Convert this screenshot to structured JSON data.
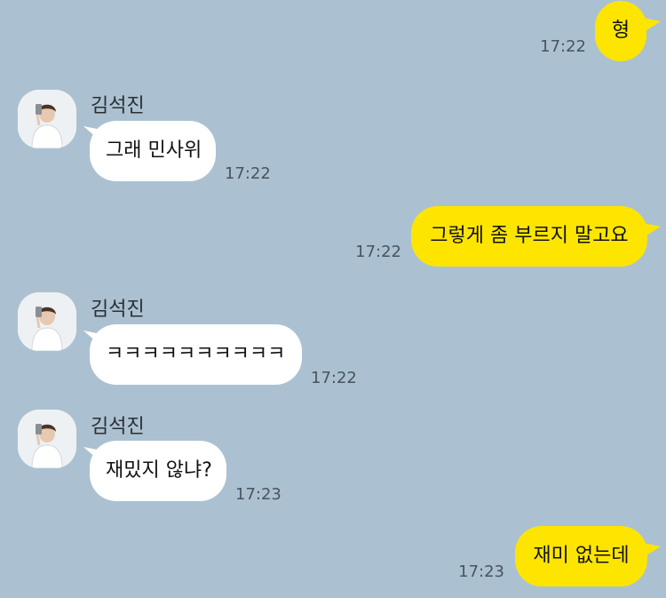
{
  "chat": {
    "messages": [
      {
        "sender": "me",
        "text": "형",
        "time": "17:22"
      },
      {
        "sender": "김석진",
        "text": "그래 민사위",
        "time": "17:22"
      },
      {
        "sender": "me",
        "text": "그렇게 좀 부르지 말고요",
        "time": "17:22"
      },
      {
        "sender": "김석진",
        "text": "ㅋㅋㅋㅋㅋㅋㅋㅋㅋㅋ",
        "time": "17:22"
      },
      {
        "sender": "김석진",
        "text": "재밌지 않냐?",
        "time": "17:23"
      },
      {
        "sender": "me",
        "text": "재미 없는데",
        "time": "17:23"
      }
    ]
  },
  "colors": {
    "background": "#abc1d1",
    "my_bubble": "#fee500",
    "their_bubble": "#ffffff",
    "timestamp": "#4a545c"
  },
  "icons": {
    "profile_avatar": "profile-photo-icon"
  }
}
